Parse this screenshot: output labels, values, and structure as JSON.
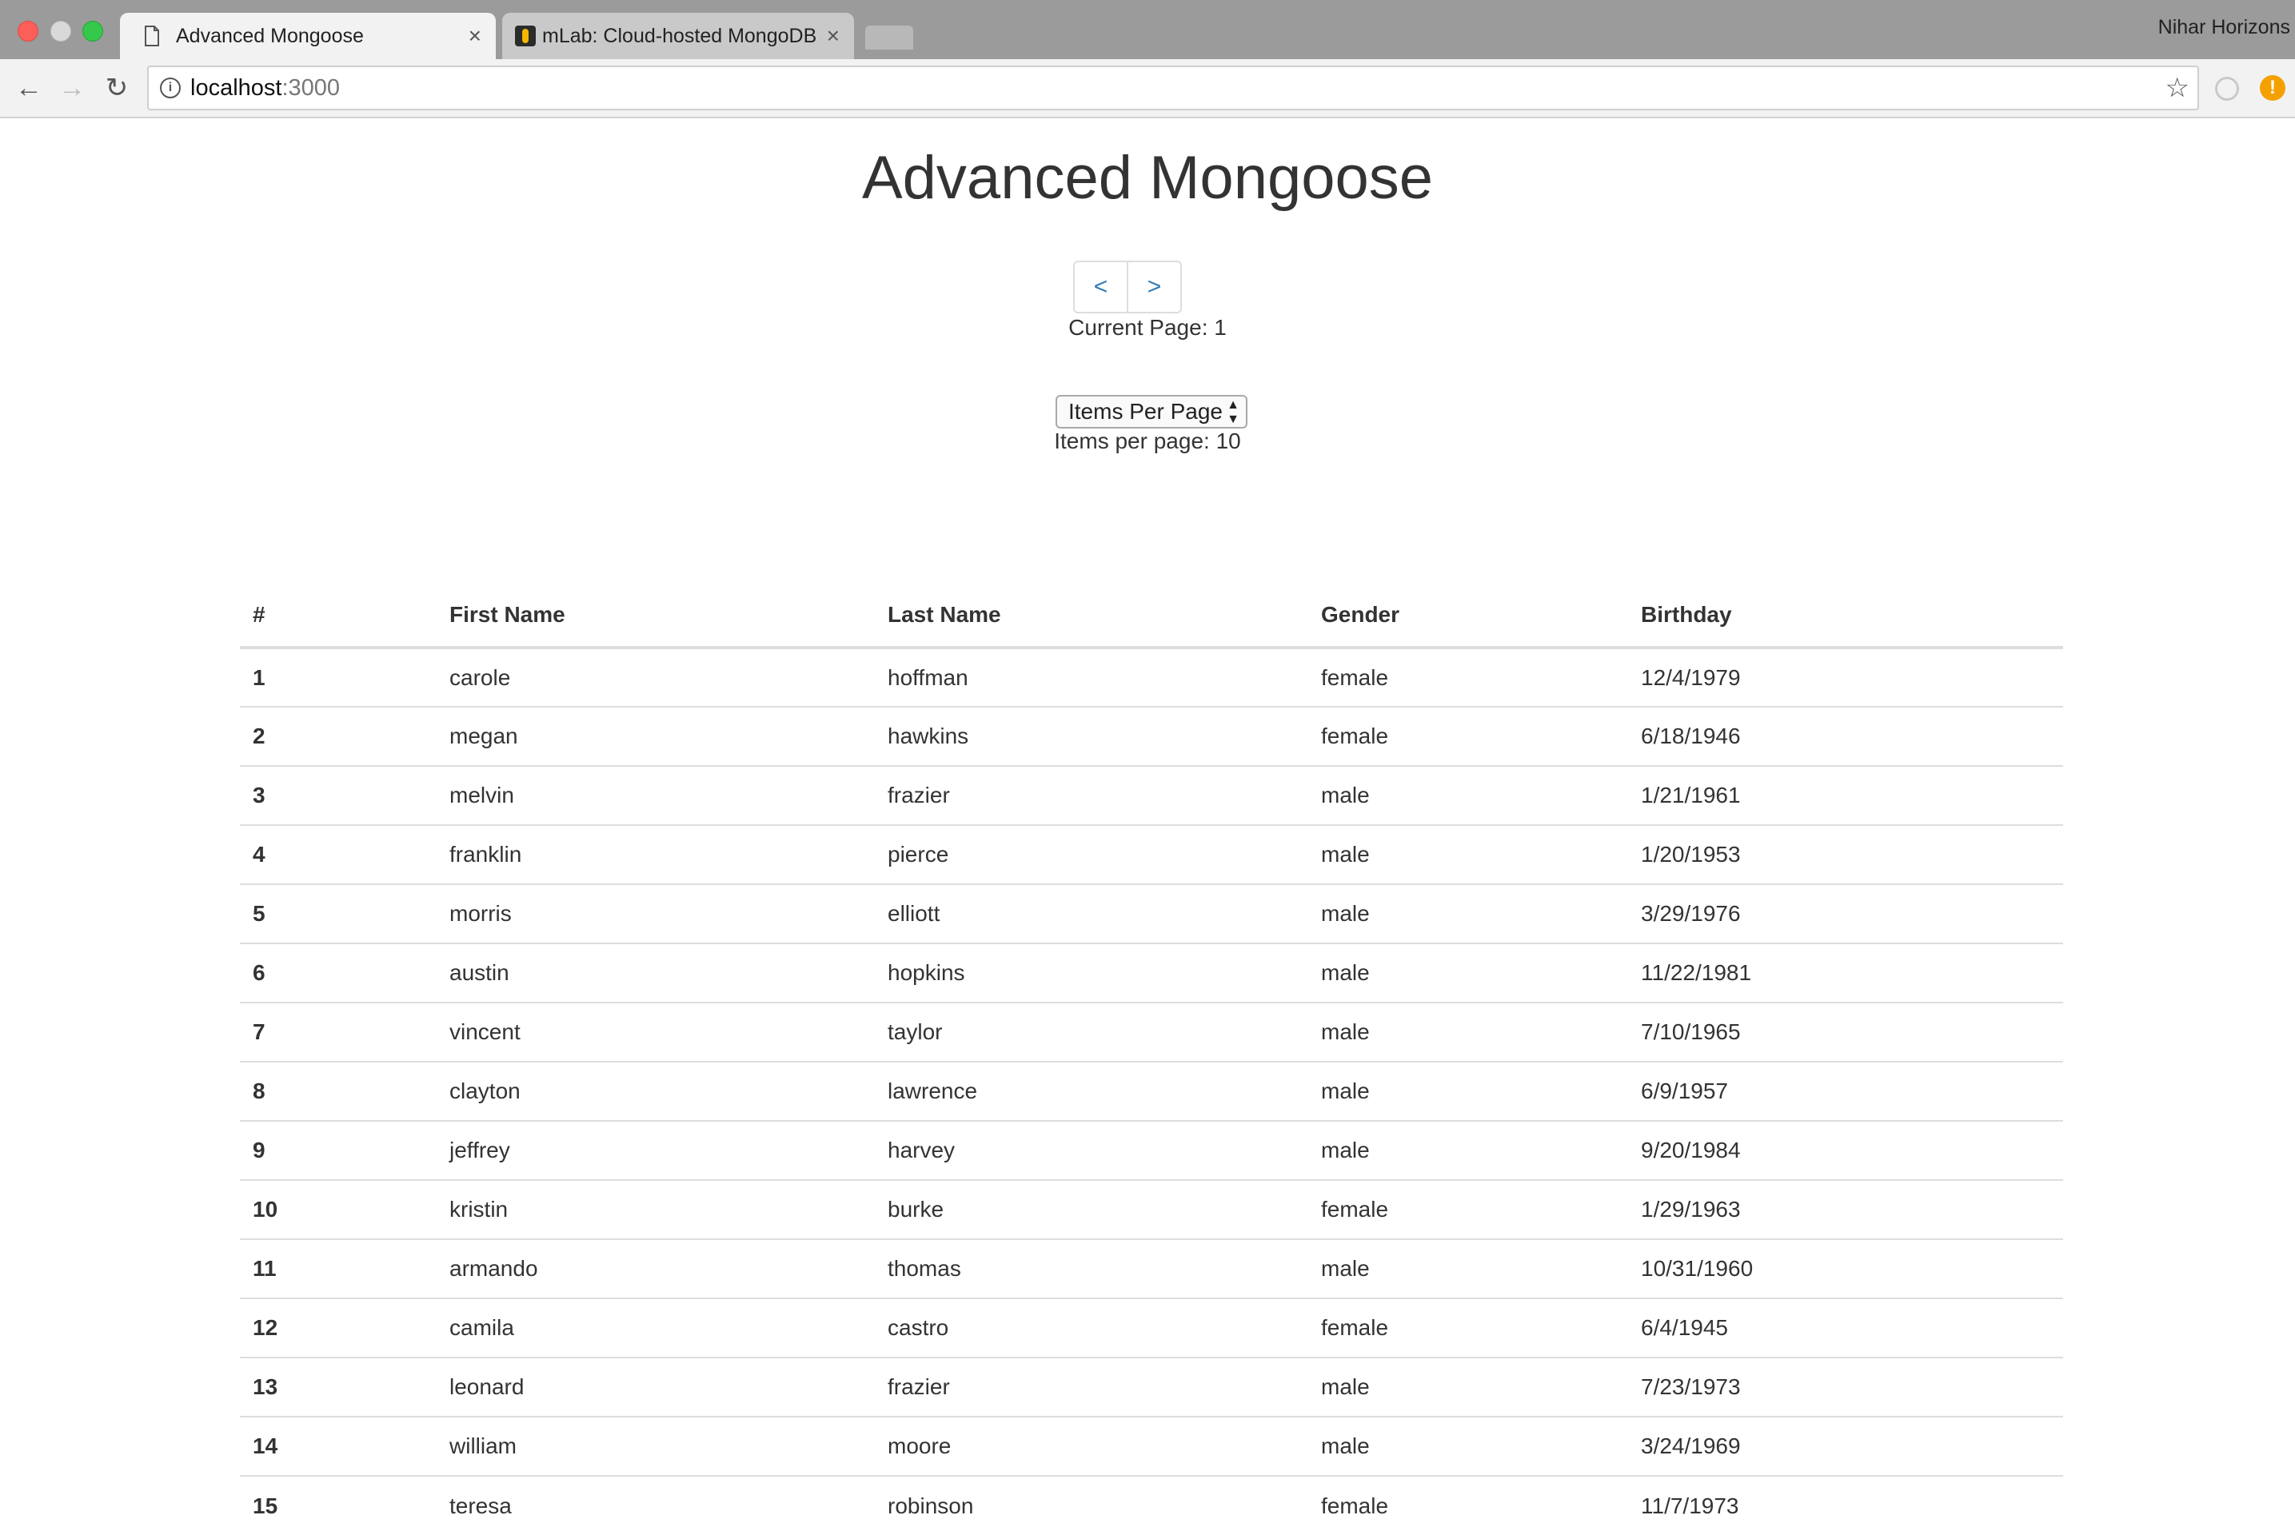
{
  "browser": {
    "tabs": [
      {
        "title": "Advanced Mongoose",
        "active": true
      },
      {
        "title": "mLab: Cloud-hosted MongoDB",
        "active": false
      }
    ],
    "profile_name": "Nihar Horizons",
    "address": {
      "host": "localhost",
      "port": ":3000"
    },
    "icons": {
      "back": "back-arrow-icon",
      "forward": "forward-arrow-icon",
      "reload": "reload-icon",
      "info": "info-icon",
      "bookmark": "star-icon"
    }
  },
  "page": {
    "title": "Advanced Mongoose",
    "pager": {
      "prev_label": "<",
      "next_label": ">"
    },
    "current_page_text": "Current Page: 1",
    "items_per_page_select": "Items Per Page",
    "items_per_page_text": "Items per page: 10"
  },
  "table": {
    "headers": [
      "#",
      "First Name",
      "Last Name",
      "Gender",
      "Birthday"
    ],
    "rows": [
      [
        "1",
        "carole",
        "hoffman",
        "female",
        "12/4/1979"
      ],
      [
        "2",
        "megan",
        "hawkins",
        "female",
        "6/18/1946"
      ],
      [
        "3",
        "melvin",
        "frazier",
        "male",
        "1/21/1961"
      ],
      [
        "4",
        "franklin",
        "pierce",
        "male",
        "1/20/1953"
      ],
      [
        "5",
        "morris",
        "elliott",
        "male",
        "3/29/1976"
      ],
      [
        "6",
        "austin",
        "hopkins",
        "male",
        "11/22/1981"
      ],
      [
        "7",
        "vincent",
        "taylor",
        "male",
        "7/10/1965"
      ],
      [
        "8",
        "clayton",
        "lawrence",
        "male",
        "6/9/1957"
      ],
      [
        "9",
        "jeffrey",
        "harvey",
        "male",
        "9/20/1984"
      ],
      [
        "10",
        "kristin",
        "burke",
        "female",
        "1/29/1963"
      ],
      [
        "11",
        "armando",
        "thomas",
        "male",
        "10/31/1960"
      ],
      [
        "12",
        "camila",
        "castro",
        "female",
        "6/4/1945"
      ],
      [
        "13",
        "leonard",
        "frazier",
        "male",
        "7/23/1973"
      ],
      [
        "14",
        "william",
        "moore",
        "male",
        "3/24/1969"
      ],
      [
        "15",
        "teresa",
        "robinson",
        "female",
        "11/7/1973"
      ]
    ]
  }
}
